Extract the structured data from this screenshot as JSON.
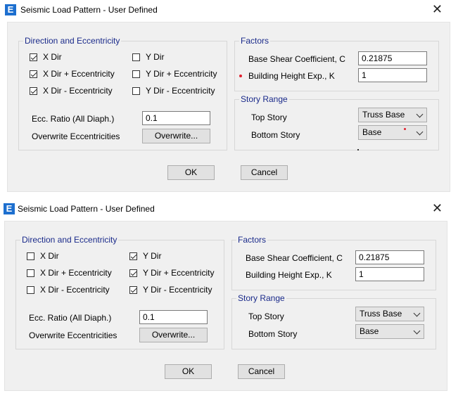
{
  "dialog1": {
    "title": "Seismic Load Pattern - User Defined",
    "close_glyph": "✕",
    "app_icon_glyph": "E",
    "direction": {
      "legend": "Direction and Eccentricity",
      "x_dir": {
        "label": "X Dir",
        "checked": true
      },
      "x_dir_plus": {
        "label": "X Dir + Eccentricity",
        "checked": true
      },
      "x_dir_minus": {
        "label": "X Dir - Eccentricity",
        "checked": true
      },
      "y_dir": {
        "label": "Y Dir",
        "checked": false
      },
      "y_dir_plus": {
        "label": "Y Dir + Eccentricity",
        "checked": false
      },
      "y_dir_minus": {
        "label": "Y Dir - Eccentricity",
        "checked": false
      },
      "ecc_ratio_label": "Ecc. Ratio (All Diaph.)",
      "ecc_ratio_value": "0.1",
      "overwrite_label": "Overwrite Eccentricities",
      "overwrite_button": "Overwrite..."
    },
    "factors": {
      "legend": "Factors",
      "base_shear_label": "Base Shear Coefficient, C",
      "base_shear_value": "0.21875",
      "height_exp_label": "Building Height Exp., K",
      "height_exp_value": "1"
    },
    "story_range": {
      "legend": "Story Range",
      "top_story_label": "Top Story",
      "top_story_value": "Truss Base",
      "bottom_story_label": "Bottom Story",
      "bottom_story_value": "Base"
    },
    "ok_button": "OK",
    "cancel_button": "Cancel"
  },
  "dialog2": {
    "title": "Seismic Load Pattern - User Defined",
    "close_glyph": "✕",
    "app_icon_glyph": "E",
    "direction": {
      "legend": "Direction and Eccentricity",
      "x_dir": {
        "label": "X Dir",
        "checked": false
      },
      "x_dir_plus": {
        "label": "X Dir + Eccentricity",
        "checked": false
      },
      "x_dir_minus": {
        "label": "X Dir - Eccentricity",
        "checked": false
      },
      "y_dir": {
        "label": "Y Dir",
        "checked": true
      },
      "y_dir_plus": {
        "label": "Y Dir + Eccentricity",
        "checked": true
      },
      "y_dir_minus": {
        "label": "Y Dir - Eccentricity",
        "checked": true
      },
      "ecc_ratio_label": "Ecc. Ratio (All Diaph.)",
      "ecc_ratio_value": "0.1",
      "overwrite_label": "Overwrite Eccentricities",
      "overwrite_button": "Overwrite..."
    },
    "factors": {
      "legend": "Factors",
      "base_shear_label": "Base Shear Coefficient, C",
      "base_shear_value": "0.21875",
      "height_exp_label": "Building Height Exp., K",
      "height_exp_value": "1"
    },
    "story_range": {
      "legend": "Story Range",
      "top_story_label": "Top Story",
      "top_story_value": "Truss Base",
      "bottom_story_label": "Bottom Story",
      "bottom_story_value": "Base"
    },
    "ok_button": "OK",
    "cancel_button": "Cancel"
  },
  "colors": {
    "legend_text": "#1a2a8a",
    "icon_blue": "#1d6fcf",
    "marker_red": "#e0202e"
  }
}
